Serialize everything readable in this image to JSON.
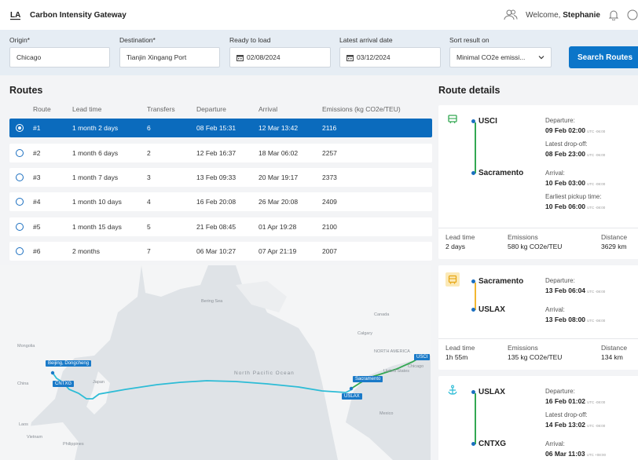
{
  "app": {
    "logo_text": "LA",
    "title": "Carbon Intensity Gateway",
    "welcome_prefix": "Welcome, ",
    "user": "Stephanie"
  },
  "search": {
    "origin_label": "Origin*",
    "origin_value": "Chicago",
    "destination_label": "Destination*",
    "destination_value": "Tianjin Xingang Port",
    "ready_label": "Ready to load",
    "ready_value": "02/08/2024",
    "arrival_label": "Latest arrival date",
    "arrival_value": "03/12/2024",
    "sort_label": "Sort result on",
    "sort_value": "Minimal CO2e emissi...",
    "button": "Search Routes"
  },
  "routes": {
    "title": "Routes",
    "columns": [
      "Route",
      "Lead time",
      "Transfers",
      "Departure",
      "Arrival",
      "Emissions (kg CO2e/TEU)"
    ],
    "rows": [
      {
        "route": "#1",
        "lead": "1 month 2 days",
        "transfers": "6",
        "departure": "08 Feb 15:31",
        "arrival": "12 Mar 13:42",
        "emissions": "2116",
        "selected": true
      },
      {
        "route": "#2",
        "lead": "1 month 6 days",
        "transfers": "2",
        "departure": "12 Feb 16:37",
        "arrival": "18 Mar 06:02",
        "emissions": "2257"
      },
      {
        "route": "#3",
        "lead": "1 month 7 days",
        "transfers": "3",
        "departure": "13 Feb 09:33",
        "arrival": "20 Mar 19:17",
        "emissions": "2373"
      },
      {
        "route": "#4",
        "lead": "1 month 10 days",
        "transfers": "4",
        "departure": "16 Feb 20:08",
        "arrival": "26 Mar 20:08",
        "emissions": "2409"
      },
      {
        "route": "#5",
        "lead": "1 month 15 days",
        "transfers": "5",
        "departure": "21 Feb 08:45",
        "arrival": "01 Apr 19:28",
        "emissions": "2100"
      },
      {
        "route": "#6",
        "lead": "2 months",
        "transfers": "7",
        "departure": "06 Mar 10:27",
        "arrival": "07 Apr 21:19",
        "emissions": "2007"
      }
    ]
  },
  "map": {
    "labels": {
      "bering": "Bering Sea",
      "canada": "Canada",
      "mongolia": "Mongolia",
      "china": "China",
      "japan": "Japan",
      "north_pacific": "North Pacific Ocean",
      "united_states": "United States",
      "mexico": "Mexico",
      "vietnam": "Vietnam",
      "philippines": "Philippines",
      "laos": "Laos",
      "calgary": "Calgary",
      "chicago": "Chicago",
      "north_america": "NORTH AMERICA"
    },
    "pins": {
      "beijing": "Beijing, Dongcheng",
      "cntxg": "CNTXG",
      "usci": "USCI",
      "sacramento": "Sacramento",
      "uslax": "USLAX"
    },
    "colors": {
      "ocean": "#2dbcd6",
      "rail": "#33a852"
    }
  },
  "details": {
    "title": "Route details",
    "legs": [
      {
        "from": "USCI",
        "to": "Sacramento",
        "departure_label": "Departure:",
        "departure": "09 Feb 02:00",
        "departure_tz": "UTC -06:00",
        "dropoff_label": "Latest drop-off:",
        "dropoff": "08 Feb 23:00",
        "dropoff_tz": "UTC -06:00",
        "arrival_label": "Arrival:",
        "arrival": "10 Feb 03:00",
        "arrival_tz": "UTC -08:00",
        "pickup_label": "Earliest pickup time:",
        "pickup": "10 Feb 06:00",
        "pickup_tz": "UTC -08:00",
        "lead_label": "Lead time",
        "lead": "2 days",
        "emissions_label": "Emissions",
        "emissions": "580 kg CO2e/TEU",
        "distance_label": "Distance",
        "distance": "3629 km",
        "color": "#33a852"
      },
      {
        "from": "Sacramento",
        "to": "USLAX",
        "departure_label": "Departure:",
        "departure": "13 Feb 06:04",
        "departure_tz": "UTC -08:00",
        "arrival_label": "Arrival:",
        "arrival": "13 Feb 08:00",
        "arrival_tz": "UTC -08:00",
        "lead_label": "Lead time",
        "lead": "1h 55m",
        "emissions_label": "Emissions",
        "emissions": "135 kg CO2e/TEU",
        "distance_label": "Distance",
        "distance": "134 km",
        "color": "#f2b731"
      },
      {
        "from": "USLAX",
        "to": "CNTXG",
        "departure_label": "Departure:",
        "departure": "16 Feb 01:02",
        "departure_tz": "UTC -08:00",
        "dropoff_label": "Latest drop-off:",
        "dropoff": "14 Feb 13:02",
        "dropoff_tz": "UTC -08:00",
        "arrival_label": "Arrival:",
        "arrival": "06 Mar 11:03",
        "arrival_tz": "UTC +08:00",
        "color": "#2dbcd6"
      }
    ]
  }
}
